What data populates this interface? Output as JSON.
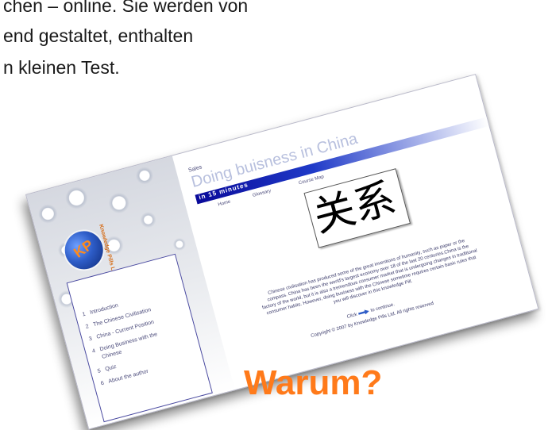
{
  "slide": {
    "intro_lines": [
      "chen – online. Sie werden von",
      "end gestaltet, enthalten",
      "n kleinen Test."
    ],
    "heading": "Warum?",
    "heading_color": "#ff7a1a"
  },
  "screenshot": {
    "logo_text": "KP",
    "brand_vertical": "Knowledge Pills Ltd",
    "section_label": "Sales",
    "title": "Doing buisness in China",
    "title_bar_text": "in 15 minutes",
    "nav": [
      "Home",
      "Glossary",
      "Course Map"
    ],
    "menu": [
      {
        "num": "1",
        "label": "Introduction"
      },
      {
        "num": "2",
        "label": "The Chinese Civilisation"
      },
      {
        "num": "3",
        "label": "China - Current Position"
      },
      {
        "num": "4",
        "label": "Doing Business with the"
      },
      {
        "num": "",
        "label": "Chinese"
      },
      {
        "num": "5",
        "label": "Quiz"
      },
      {
        "num": "6",
        "label": "About the author"
      }
    ],
    "chinese_word": "关系",
    "body": "Chinese civilisation has produced some of the great inventions of humanity, such as paper or the compass. China has been the world's largest economy over 18 of the last 20 centuries.China is the factory of the world, but it is also a tremendous consumer market that is undergoing changes in traditional consumer habits. However, doing business with the Chinese sometime requires certain basic rules that you will discover in this knowledge Pill.",
    "continue_before": "Click",
    "continue_after": "to continue.",
    "copyright": "Copyright © 2007 by Knowledge Pills Ltd. All rights reserved",
    "colors": {
      "title_bar": "#0a0a9a",
      "brand": "#d56b15",
      "logo_letters": "#ff8a1c"
    }
  }
}
